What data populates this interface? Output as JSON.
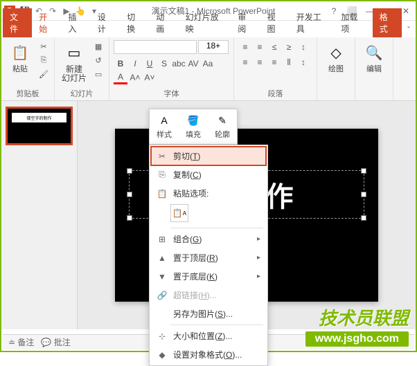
{
  "titlebar": {
    "app_letter": "P",
    "title": "演示文稿1 - Microsoft PowerPoint"
  },
  "qat": {
    "save": "💾",
    "undo": "↶",
    "redo": "↷",
    "start": "▶",
    "touch": "👆",
    "more": "▾"
  },
  "win": {
    "help": "?",
    "full": "⬜",
    "min": "—",
    "max": "▢",
    "close": "✕"
  },
  "tabs": {
    "file": "文件",
    "home": "开始",
    "insert": "插入",
    "design": "设计",
    "trans": "切换",
    "anim": "动画",
    "show": "幻灯片放映",
    "review": "审阅",
    "view": "视图",
    "dev": "开发工具",
    "addin": "加载项",
    "format": "格式",
    "toggle": "ˇ"
  },
  "ribbon": {
    "clipboard": {
      "label": "剪贴板",
      "paste": "粘贴",
      "paste_icon": "📋",
      "cut_icon": "✂",
      "copy_icon": "⎘",
      "brush_icon": "🖌"
    },
    "slides": {
      "label": "幻灯片",
      "new": "新建",
      "new2": "幻灯片",
      "layout_icon": "▦",
      "reset_icon": "↺",
      "section_icon": "▭"
    },
    "font": {
      "label": "字体",
      "size": "18+",
      "b": "B",
      "i": "I",
      "u": "U",
      "s": "S",
      "shadow": "abc",
      "av": "AV",
      "clear": "Aa",
      "inc": "A˄",
      "dec": "A˅",
      "color": "A"
    },
    "para": {
      "label": "段落",
      "bullets": "≡",
      "numbers": "≡",
      "indent_dec": "≤",
      "indent_inc": "≥",
      "direction": "↕",
      "align_l": "≡",
      "align_c": "≡",
      "align_r": "≡",
      "cols": "⫴",
      "spacing": "↕"
    },
    "draw": {
      "label": "绘图",
      "icon": "◇"
    },
    "edit": {
      "label": "编辑",
      "icon": "🔍"
    }
  },
  "ctxtools": {
    "style": "样式",
    "fill": "填充",
    "outline": "轮廓",
    "style_icon": "A",
    "fill_icon": "🪣",
    "outline_icon": "✎"
  },
  "ctxmenu": {
    "cut": "剪切",
    "cut_key": "T",
    "cut_icon": "✂",
    "copy": "复制",
    "copy_key": "C",
    "copy_icon": "⎘",
    "paste_label": "粘贴选项:",
    "paste_icon": "📋",
    "group": "组合",
    "group_key": "G",
    "group_icon": "⊞",
    "front": "置于顶层",
    "front_key": "R",
    "front_icon": "▲",
    "back": "置于底层",
    "back_key": "K",
    "back_icon": "▼",
    "link": "超链接",
    "link_key": "H",
    "link_icon": "🔗",
    "saveimg": "另存为图片",
    "saveimg_key": "S",
    "size": "大小和位置",
    "size_key": "Z",
    "size_icon": "⊹",
    "format": "设置对象格式",
    "format_key": "O",
    "format_icon": "◆"
  },
  "slide": {
    "text": "镂  制作",
    "thumb_text": "镂空字的制作"
  },
  "statusbar": {
    "notes": "备注",
    "comments": "批注"
  },
  "watermark": {
    "text": "技术员联盟",
    "url": "www.jsgho.com"
  }
}
